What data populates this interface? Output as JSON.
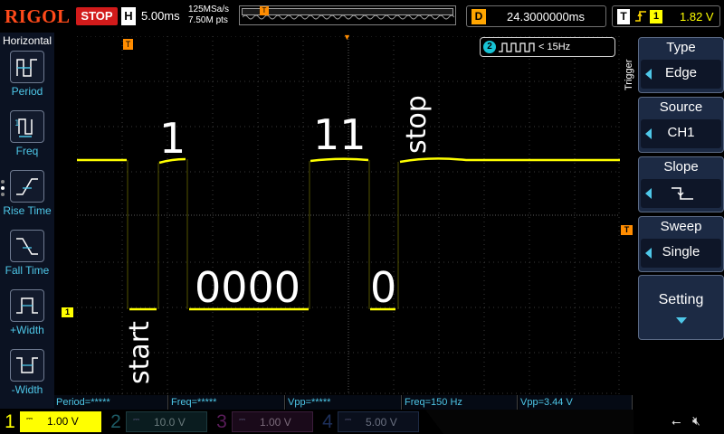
{
  "topbar": {
    "brand": "RIGOL",
    "run_state": "STOP",
    "timebase_letter": "H",
    "timebase": "5.00ms",
    "sample_rate": "125MSa/s",
    "memory_depth": "7.50M pts",
    "trigger_marker": "T",
    "delay_letter": "D",
    "delay": "24.3000000ms",
    "trigger_letter": "T",
    "trigger_edge_icon": "rising-edge-icon",
    "trigger_channel": "1",
    "trigger_level": "1.82 V"
  },
  "left_panel": {
    "title": "Horizontal",
    "items": [
      {
        "label": "Period",
        "icon": "period-icon"
      },
      {
        "label": "Freq",
        "icon": "freq-icon"
      },
      {
        "label": "Rise Time",
        "icon": "rise-time-icon"
      },
      {
        "label": "Fall Time",
        "icon": "fall-time-icon"
      },
      {
        "label": "+Width",
        "icon": "positive-width-icon"
      },
      {
        "label": "-Width",
        "icon": "negative-width-icon"
      }
    ]
  },
  "screen": {
    "annotations": {
      "bit1": "1",
      "bit11": "11",
      "stop": "stop",
      "start": "start",
      "bits0000": "0000",
      "bit0": "0"
    },
    "ch1_marker": "1",
    "trigger_level_marker": "T",
    "time_position_marker": "T",
    "ch2_freq_badge": "2",
    "ch2_freq_text": "< 15Hz"
  },
  "right_panel": {
    "side_label": "Trigger",
    "menus": [
      {
        "title": "Type",
        "value": "Edge"
      },
      {
        "title": "Source",
        "value": "CH1"
      },
      {
        "title": "Slope",
        "value": "falling-edge-icon"
      },
      {
        "title": "Sweep",
        "value": "Single"
      }
    ],
    "setting_label": "Setting"
  },
  "measurements": [
    "Period=*****",
    "Freq=*****",
    "Vpp=*****",
    "Freq=150 Hz",
    "Vpp=3.44 V"
  ],
  "channels": [
    {
      "num": "1",
      "scale": "1.00 V",
      "color": "#ffff00",
      "active": true
    },
    {
      "num": "2",
      "scale": "10.0 V",
      "color": "#17c4d6",
      "active": false
    },
    {
      "num": "3",
      "scale": "1.00 V",
      "color": "#d63cd6",
      "active": false
    },
    {
      "num": "4",
      "scale": "5.00 V",
      "color": "#3a6cd6",
      "active": false
    }
  ],
  "colors": {
    "ch1": "#ffff00",
    "accent": "#4ec7e8",
    "trigger": "#ff8c00",
    "stop": "#d21b1b"
  }
}
